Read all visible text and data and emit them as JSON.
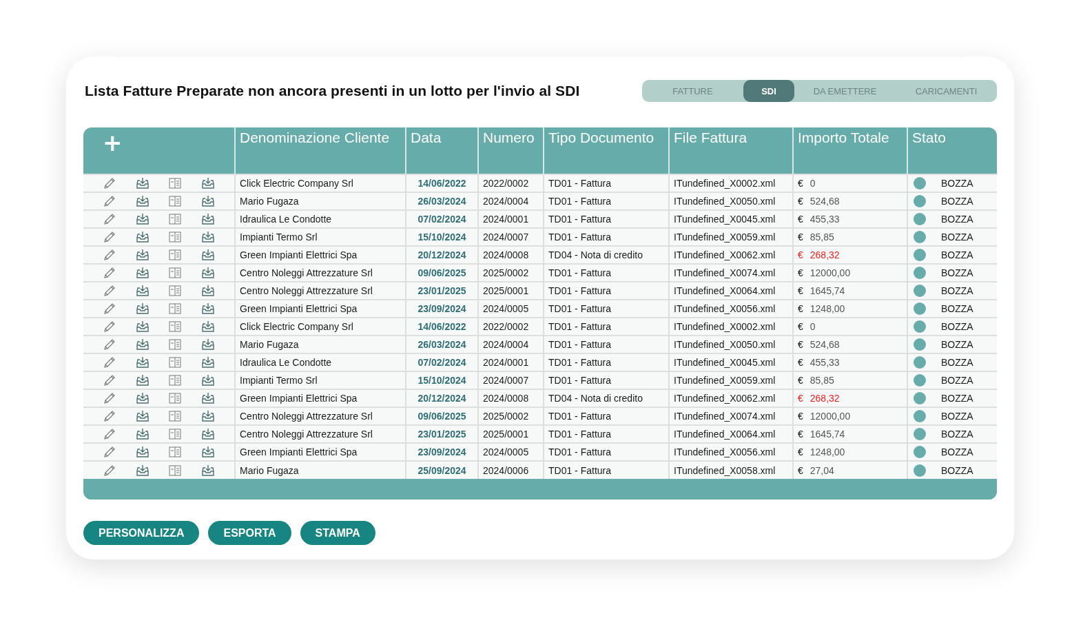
{
  "title": "Lista Fatture Preparate non ancora presenti in un lotto per l'invio al SDI",
  "tabs": [
    {
      "label": "FATTURE",
      "selected": false
    },
    {
      "label": "SDI",
      "selected": true
    },
    {
      "label": "DA EMETTERE",
      "selected": false
    },
    {
      "label": "CARICAMENTI",
      "selected": false
    }
  ],
  "table": {
    "add_label": "+",
    "columns": [
      "Denominazione Cliente",
      "Data",
      "Numero",
      "Tipo Documento",
      "File Fattura",
      "Importo Totale",
      "Stato"
    ],
    "rows": [
      {
        "client": "Click Electric Company Srl",
        "date": "14/06/2022",
        "number": "2022/0002",
        "type": "TD01 - Fattura",
        "file": "ITundefined_X0002.xml",
        "currency": "€",
        "amount": "0",
        "negative": false,
        "status": "BOZZA",
        "color": "#66acab"
      },
      {
        "client": "Mario Fugaza",
        "date": "26/03/2024",
        "number": "2024/0004",
        "type": "TD01 - Fattura",
        "file": "ITundefined_X0050.xml",
        "currency": "€",
        "amount": "524,68",
        "negative": false,
        "status": "BOZZA",
        "color": "#66acab"
      },
      {
        "client": "Idraulica Le Condotte",
        "date": "07/02/2024",
        "number": "2024/0001",
        "type": "TD01 - Fattura",
        "file": "ITundefined_X0045.xml",
        "currency": "€",
        "amount": "455,33",
        "negative": false,
        "status": "BOZZA",
        "color": "#66acab"
      },
      {
        "client": "Impianti Termo Srl",
        "date": "15/10/2024",
        "number": "2024/0007",
        "type": "TD01 - Fattura",
        "file": "ITundefined_X0059.xml",
        "currency": "€",
        "amount": "85,85",
        "negative": false,
        "status": "BOZZA",
        "color": "#66acab"
      },
      {
        "client": "Green Impianti Elettrici Spa",
        "date": "20/12/2024",
        "number": "2024/0008",
        "type": "TD04 - Nota di credito",
        "file": "ITundefined_X0062.xml",
        "currency": "€",
        "amount": "268,32",
        "negative": true,
        "status": "BOZZA",
        "color": "#66acab"
      },
      {
        "client": "Centro Noleggi Attrezzature Srl",
        "date": "09/06/2025",
        "number": "2025/0002",
        "type": "TD01 - Fattura",
        "file": "ITundefined_X0074.xml",
        "currency": "€",
        "amount": "12000,00",
        "negative": false,
        "status": "BOZZA",
        "color": "#66acab"
      },
      {
        "client": "Centro Noleggi Attrezzature Srl",
        "date": "23/01/2025",
        "number": "2025/0001",
        "type": "TD01 - Fattura",
        "file": "ITundefined_X0064.xml",
        "currency": "€",
        "amount": "1645,74",
        "negative": false,
        "status": "BOZZA",
        "color": "#66acab"
      },
      {
        "client": "Green Impianti Elettrici Spa",
        "date": "23/09/2024",
        "number": "2024/0005",
        "type": "TD01 - Fattura",
        "file": "ITundefined_X0056.xml",
        "currency": "€",
        "amount": "1248,00",
        "negative": false,
        "status": "BOZZA",
        "color": "#66acab"
      },
      {
        "client": "Click Electric Company Srl",
        "date": "14/06/2022",
        "number": "2022/0002",
        "type": "TD01 - Fattura",
        "file": "ITundefined_X0002.xml",
        "currency": "€",
        "amount": "0",
        "negative": false,
        "status": "BOZZA",
        "color": "#66acab"
      },
      {
        "client": "Mario Fugaza",
        "date": "26/03/2024",
        "number": "2024/0004",
        "type": "TD01 - Fattura",
        "file": "ITundefined_X0050.xml",
        "currency": "€",
        "amount": "524,68",
        "negative": false,
        "status": "BOZZA",
        "color": "#66acab"
      },
      {
        "client": "Idraulica Le Condotte",
        "date": "07/02/2024",
        "number": "2024/0001",
        "type": "TD01 - Fattura",
        "file": "ITundefined_X0045.xml",
        "currency": "€",
        "amount": "455,33",
        "negative": false,
        "status": "BOZZA",
        "color": "#66acab"
      },
      {
        "client": "Impianti Termo Srl",
        "date": "15/10/2024",
        "number": "2024/0007",
        "type": "TD01 - Fattura",
        "file": "ITundefined_X0059.xml",
        "currency": "€",
        "amount": "85,85",
        "negative": false,
        "status": "BOZZA",
        "color": "#66acab"
      },
      {
        "client": "Green Impianti Elettrici Spa",
        "date": "20/12/2024",
        "number": "2024/0008",
        "type": "TD04 - Nota di credito",
        "file": "ITundefined_X0062.xml",
        "currency": "€",
        "amount": "268,32",
        "negative": true,
        "status": "BOZZA",
        "color": "#66acab"
      },
      {
        "client": "Centro Noleggi Attrezzature Srl",
        "date": "09/06/2025",
        "number": "2025/0002",
        "type": "TD01 - Fattura",
        "file": "ITundefined_X0074.xml",
        "currency": "€",
        "amount": "12000,00",
        "negative": false,
        "status": "BOZZA",
        "color": "#66acab"
      },
      {
        "client": "Centro Noleggi Attrezzature Srl",
        "date": "23/01/2025",
        "number": "2025/0001",
        "type": "TD01 - Fattura",
        "file": "ITundefined_X0064.xml",
        "currency": "€",
        "amount": "1645,74",
        "negative": false,
        "status": "BOZZA",
        "color": "#66acab"
      },
      {
        "client": "Green Impianti Elettrici Spa",
        "date": "23/09/2024",
        "number": "2024/0005",
        "type": "TD01 - Fattura",
        "file": "ITundefined_X0056.xml",
        "currency": "€",
        "amount": "1248,00",
        "negative": false,
        "status": "BOZZA",
        "color": "#66acab"
      },
      {
        "client": "Mario Fugaza",
        "date": "25/09/2024",
        "number": "2024/0006",
        "type": "TD01 - Fattura",
        "file": "ITundefined_X0058.xml",
        "currency": "€",
        "amount": "27,04",
        "negative": false,
        "status": "BOZZA",
        "color": "#66acab"
      }
    ]
  },
  "buttons": [
    "PERSONALIZZA",
    "ESPORTA",
    "STAMPA"
  ]
}
